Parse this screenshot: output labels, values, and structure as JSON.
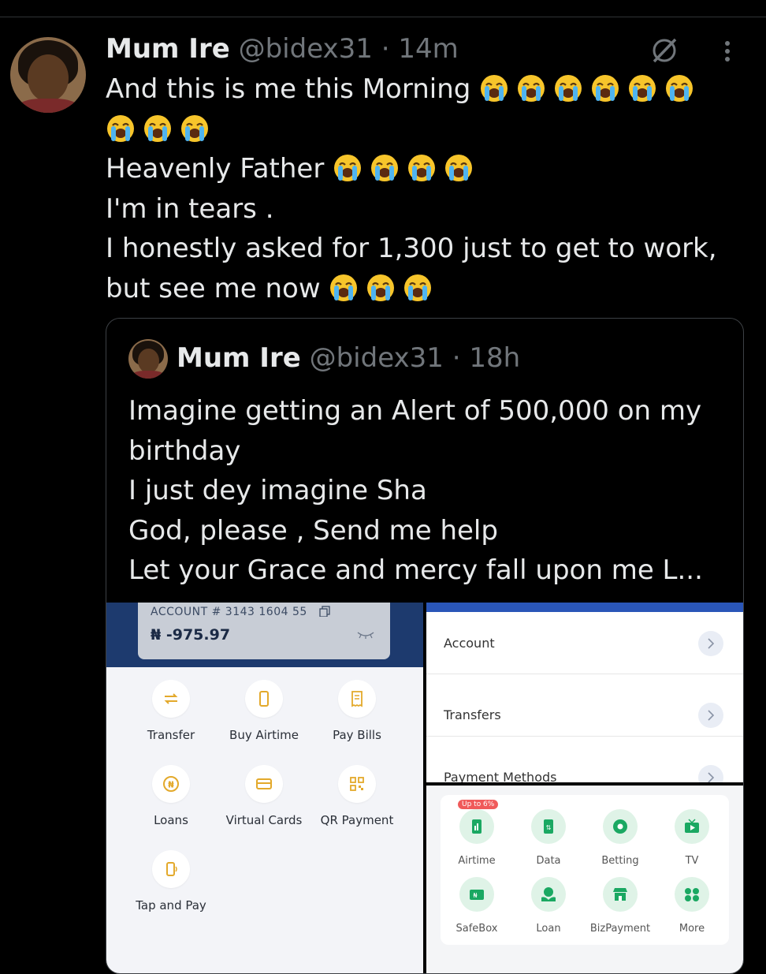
{
  "tweet": {
    "name": "Mum Ire",
    "handle": "@bidex31",
    "time": "· 14m",
    "lines": [
      {
        "text": "And this is me this Morning",
        "emoji": 6
      },
      {
        "text": "",
        "emoji": 3
      },
      {
        "text": "Heavenly Father",
        "emoji": 4
      },
      {
        "text": "I'm in tears .",
        "emoji": 0
      },
      {
        "text": "I honestly asked for 1,300 just to get to work,",
        "emoji": 0
      },
      {
        "text": "but see me now",
        "emoji": 3
      }
    ],
    "emoji_name": "loudly-crying-face"
  },
  "quote": {
    "name": "Mum Ire",
    "handle": "@bidex31",
    "time": "· 18h",
    "lines": [
      "Imagine getting an Alert of 500,000 on my",
      "birthday",
      "I just dey imagine Sha",
      "God, please , Send me help",
      "Let your Grace and mercy fall upon me L..."
    ]
  },
  "bank_app": {
    "account_number": "ACCOUNT # 3143 1604 55",
    "balance": "₦ -975.97",
    "actions": [
      "Transfer",
      "Buy Airtime",
      "Pay Bills",
      "Loans",
      "Virtual Cards",
      "QR Payment",
      "Tap and Pay"
    ]
  },
  "menu_app": {
    "items": [
      "Account",
      "Transfers",
      "Payment Methods"
    ]
  },
  "services_app": {
    "badge": "Up to 6%",
    "items": [
      "Airtime",
      "Data",
      "Betting",
      "TV",
      "SafeBox",
      "Loan",
      "BizPayment",
      "More"
    ]
  },
  "colors": {
    "background": "#000000",
    "text": "#e7e9ea",
    "muted": "#71767b",
    "bank_blue": "#1d3a6e",
    "bank_gold": "#e3a92b",
    "service_green": "#1aa862"
  }
}
